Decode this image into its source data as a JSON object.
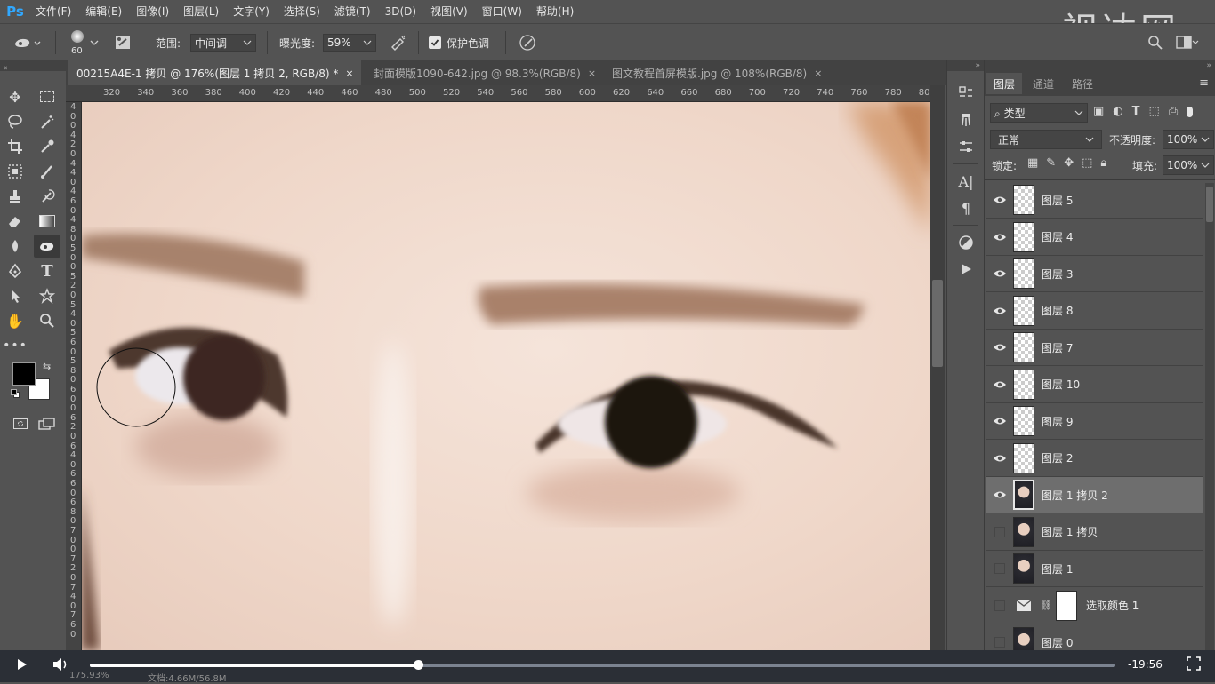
{
  "app": {
    "logo": "Ps",
    "watermark": "视达网"
  },
  "menu": [
    "文件(F)",
    "编辑(E)",
    "图像(I)",
    "图层(L)",
    "文字(Y)",
    "选择(S)",
    "滤镜(T)",
    "3D(D)",
    "视图(V)",
    "窗口(W)",
    "帮助(H)"
  ],
  "options": {
    "brush_size": "60",
    "range_label": "范围:",
    "range_value": "中间调",
    "exposure_label": "曝光度:",
    "exposure_value": "59%",
    "protect_tones_label": "保护色调",
    "protect_tones_checked": true
  },
  "tabs": [
    {
      "label": "00215A4E-1 拷贝 @ 176%(图层 1 拷贝 2, RGB/8) *",
      "close": "×",
      "active": true
    },
    {
      "label": "封面模版1090-642.jpg @ 98.3%(RGB/8)",
      "close": "×",
      "active": false
    },
    {
      "label": "图文教程首屏模版.jpg @ 108%(RGB/8)",
      "close": "×",
      "active": false
    }
  ],
  "ruler_h": [
    "320",
    "340",
    "360",
    "380",
    "400",
    "420",
    "440",
    "460",
    "480",
    "500",
    "520",
    "540",
    "560",
    "580",
    "600",
    "620",
    "640",
    "660",
    "680",
    "700",
    "720",
    "740",
    "760",
    "780",
    "800"
  ],
  "ruler_v": [
    "4",
    "0",
    "0",
    "4",
    "2",
    "0",
    "4",
    "4",
    "0",
    "4",
    "6",
    "0",
    "4",
    "8",
    "0",
    "5",
    "0",
    "0",
    "5",
    "2",
    "0",
    "5",
    "4",
    "0",
    "5",
    "6",
    "0",
    "5",
    "8",
    "0",
    "6",
    "0",
    "0",
    "6",
    "2",
    "0",
    "6",
    "4",
    "0",
    "6",
    "6",
    "0",
    "6",
    "8",
    "0",
    "7",
    "0",
    "0",
    "7",
    "2",
    "0",
    "7",
    "4",
    "0",
    "7",
    "6",
    "0"
  ],
  "layers_panel": {
    "tabs": [
      "图层",
      "通道",
      "路径"
    ],
    "filter_kind": "类型",
    "blend_mode": "正常",
    "opacity_label": "不透明度:",
    "opacity_value": "100%",
    "lock_label": "锁定:",
    "fill_label": "填充:",
    "fill_value": "100%",
    "layers": [
      {
        "name": "图层 5",
        "visible": true,
        "thumb": "transparent",
        "selected": false
      },
      {
        "name": "图层 4",
        "visible": true,
        "thumb": "transparent",
        "selected": false
      },
      {
        "name": "图层 3",
        "visible": true,
        "thumb": "transparent",
        "selected": false
      },
      {
        "name": "图层 8",
        "visible": true,
        "thumb": "transparent",
        "selected": false
      },
      {
        "name": "图层 7",
        "visible": true,
        "thumb": "transparent",
        "selected": false
      },
      {
        "name": "图层 10",
        "visible": true,
        "thumb": "transparent",
        "selected": false
      },
      {
        "name": "图层 9",
        "visible": true,
        "thumb": "transparent",
        "selected": false
      },
      {
        "name": "图层 2",
        "visible": true,
        "thumb": "transparent",
        "selected": false
      },
      {
        "name": "图层 1 拷贝 2",
        "visible": true,
        "thumb": "photo",
        "selected": true
      },
      {
        "name": "图层 1 拷贝",
        "visible": false,
        "thumb": "photo",
        "selected": false
      },
      {
        "name": "图层 1",
        "visible": false,
        "thumb": "photo",
        "selected": false
      },
      {
        "name": "选取颜色 1",
        "visible": false,
        "thumb": "adjustment",
        "selected": false
      },
      {
        "name": "图层 0",
        "visible": false,
        "thumb": "photo",
        "selected": false
      }
    ]
  },
  "video": {
    "time": "-19:56",
    "progress": 0.32
  },
  "status": {
    "zoom": "175.93%",
    "doc": "文档:4.66M/56.8M"
  },
  "colors": {
    "foreground": "#000000",
    "background": "#ffffff",
    "accent": "#31a8ff"
  }
}
